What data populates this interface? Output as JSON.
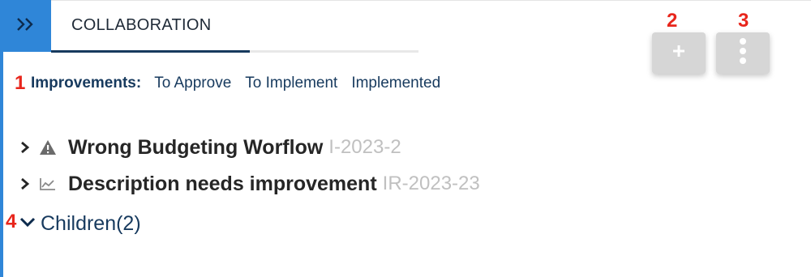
{
  "sidebar_toggle": {
    "icon": "double-chevron-right-icon"
  },
  "tab": {
    "label": "COLLABORATION"
  },
  "toolbar": {
    "add_icon": "plus-icon",
    "more_icon": "vertical-ellipsis-icon"
  },
  "annotations": [
    "1",
    "2",
    "3",
    "4"
  ],
  "improvements": {
    "label": "Improvements:",
    "filters": [
      "To Approve",
      "To Implement",
      "Implemented"
    ]
  },
  "items": [
    {
      "icon": "warning-icon",
      "title": "Wrong Budgeting Worflow",
      "id": "I-2023-2"
    },
    {
      "icon": "line-chart-icon",
      "title": "Description needs improvement",
      "id": "IR-2023-23"
    }
  ],
  "children": {
    "label": "Children(2)"
  },
  "colors": {
    "accent": "#2f86d8",
    "navy": "#173a5e",
    "annotation": "#e8261c",
    "muted_id": "#c0c0c0",
    "button_bg": "#d6d6d6"
  }
}
